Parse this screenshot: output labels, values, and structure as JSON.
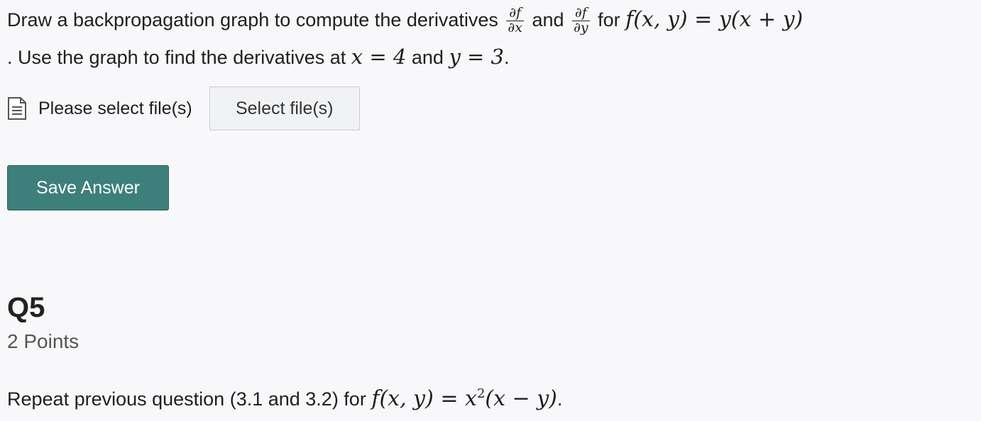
{
  "question4": {
    "prefix": "Draw a backpropagation graph to compute the derivatives",
    "dfdx_num": "∂f",
    "dfdx_den": "∂x",
    "and1": "and",
    "dfdy_num": "∂f",
    "dfdy_den": "∂y",
    "for1": "for",
    "function": "f(x, y) = y(x + y)",
    "line2_start": ". Use the graph to find the derivatives at",
    "x_eq": "x = 4",
    "and2": "and",
    "y_eq": "y = 3",
    "period": "."
  },
  "upload": {
    "icon": "document-icon",
    "label": "Please select file(s)",
    "button_label": "Select file(s)"
  },
  "save": {
    "label": "Save Answer"
  },
  "question5": {
    "title": "Q5",
    "points": "2 Points",
    "text_prefix": "Repeat previous question (3.1 and 3.2) for",
    "function_start": "f(x, y) = x",
    "exponent": "2",
    "function_end": "(x − y)",
    "period": "."
  },
  "colors": {
    "save_button": "#3d7f7b",
    "background": "#f8f8fa"
  }
}
